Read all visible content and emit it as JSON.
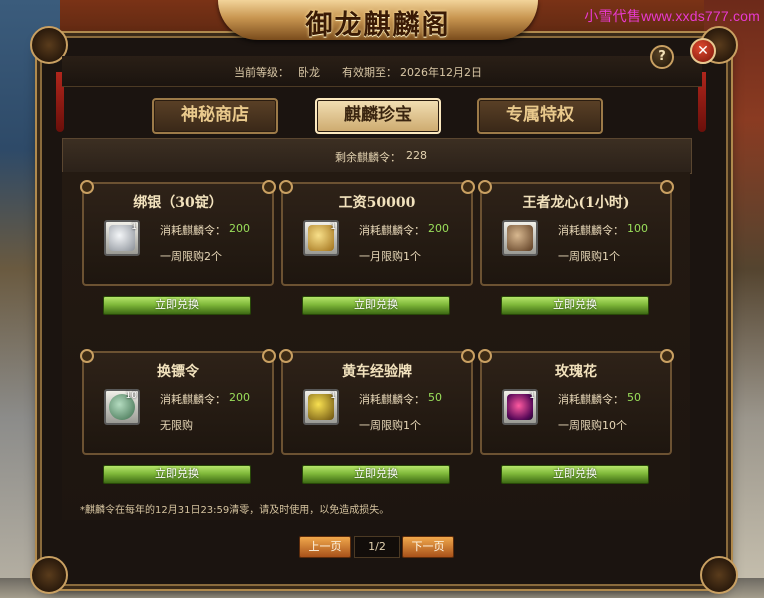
{
  "watermark": "小雪代售www.xxds777.com",
  "window": {
    "title": "御龙麒麟阁",
    "help_label": "?",
    "close_label": "✕"
  },
  "header": {
    "level_label": "当前等级：",
    "level_value": "卧龙",
    "expire_label": "有效期至：",
    "expire_value": "2026年12月2日"
  },
  "tabs": [
    {
      "label": "神秘商店",
      "active": false
    },
    {
      "label": "麒麟珍宝",
      "active": true
    },
    {
      "label": "专属特权",
      "active": false
    }
  ],
  "remaining": {
    "label": "剩余麒麟令：",
    "value": "228"
  },
  "items": [
    {
      "name": "绑银（30锭）",
      "qty": "1",
      "icon": "silver-ingot-icon",
      "cost_label": "消耗麒麟令：",
      "cost": "200",
      "limit": "一周限购2个",
      "button": "立即兑换",
      "icon_color": "#b8bcc4"
    },
    {
      "name": "工资50000",
      "qty": "1",
      "icon": "gold-scroll-icon",
      "cost_label": "消耗麒麟令：",
      "cost": "200",
      "limit": "一月限购1个",
      "button": "立即兑换",
      "icon_color": "#d8a63c"
    },
    {
      "name": "王者龙心(1小时)",
      "qty": "",
      "icon": "dragon-heart-icon",
      "cost_label": "消耗麒麟令：",
      "cost": "100",
      "limit": "一周限购1个",
      "button": "立即兑换",
      "icon_color": "#8a6a4a"
    },
    {
      "name": "换镖令",
      "qty": "10",
      "icon": "escort-token-icon",
      "cost_label": "消耗麒麟令：",
      "cost": "200",
      "limit": "无限购",
      "button": "立即兑换",
      "icon_color": "#5a9a6a"
    },
    {
      "name": "黄车经验牌",
      "qty": "1",
      "icon": "yellow-cart-icon",
      "cost_label": "消耗麒麟令：",
      "cost": "50",
      "limit": "一周限购1个",
      "button": "立即兑换",
      "icon_color": "#c8a020"
    },
    {
      "name": "玫瑰花",
      "qty": "1",
      "icon": "rose-icon",
      "cost_label": "消耗麒麟令：",
      "cost": "50",
      "limit": "一周限购10个",
      "button": "立即兑换",
      "icon_color": "#c0287a"
    }
  ],
  "notice": "*麒麟令在每年的12月31日23:59清零，请及时使用，以免造成损失。",
  "pager": {
    "prev": "上一页",
    "indicator": "1/2",
    "next": "下一页"
  }
}
